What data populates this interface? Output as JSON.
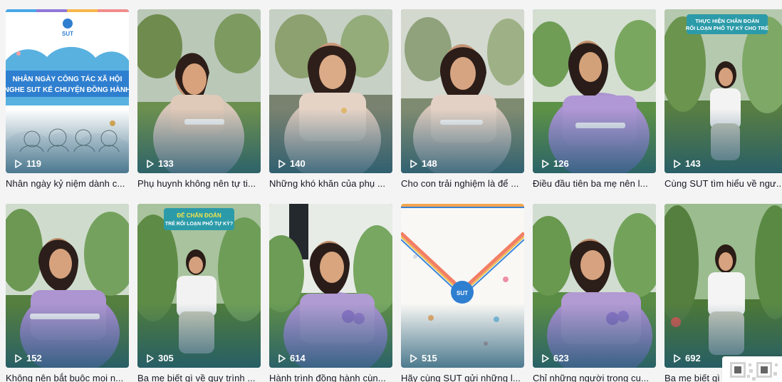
{
  "videos": [
    {
      "views": "119",
      "caption": "Nhân ngày kỷ niệm dành c..."
    },
    {
      "views": "133",
      "caption": "Phụ huynh không nên tự ti..."
    },
    {
      "views": "140",
      "caption": "Những khó khăn của phụ ..."
    },
    {
      "views": "148",
      "caption": "Cho con trải nghiệm là để ..."
    },
    {
      "views": "126",
      "caption": "Điều đầu tiên ba mẹ nên l..."
    },
    {
      "views": "143",
      "caption": "Cùng SUT tìm hiểu về ngư..."
    },
    {
      "views": "152",
      "caption": "Không nên bắt buộc mọi n..."
    },
    {
      "views": "305",
      "caption": "Ba mẹ biết gì về quy trình ..."
    },
    {
      "views": "614",
      "caption": "Hành trình đồng hành cùn..."
    },
    {
      "views": "515",
      "caption": "Hãy cùng SUT gửi những l..."
    },
    {
      "views": "623",
      "caption": "Chỉ những người trong cu..."
    },
    {
      "views": "692",
      "caption": "Ba mẹ biết gì"
    }
  ],
  "thumb_texts": {
    "0": {
      "brand": "SUT",
      "headline_line1": "NHÂN NGÀY CÔNG TÁC XÃ HỘI",
      "headline_line2": "NGHE SUT KỂ CHUYỆN ĐỒNG HÀNH"
    },
    "5": {
      "headline_line1": "THỰC HIỆN CHẨN ĐOÁN",
      "headline_line2": "RỐI LOẠN PHỔ TỰ KỶ CHO TRẺ"
    },
    "7": {
      "headline_line1": "ĐỂ CHẨN ĐOÁN",
      "headline_line2": "TRẺ RỐI LOẠN PHỔ TỰ KỶ?"
    },
    "9": {
      "brand": "SUT"
    }
  },
  "icons": {
    "play": "play-icon",
    "qr": "qr-code-icon"
  },
  "colors": {
    "text": "#161823",
    "views": "#ffffff",
    "gradient": "#1c5671",
    "brand_blue": "#2f7fd0",
    "banner_teal": "#2c9ba9"
  }
}
